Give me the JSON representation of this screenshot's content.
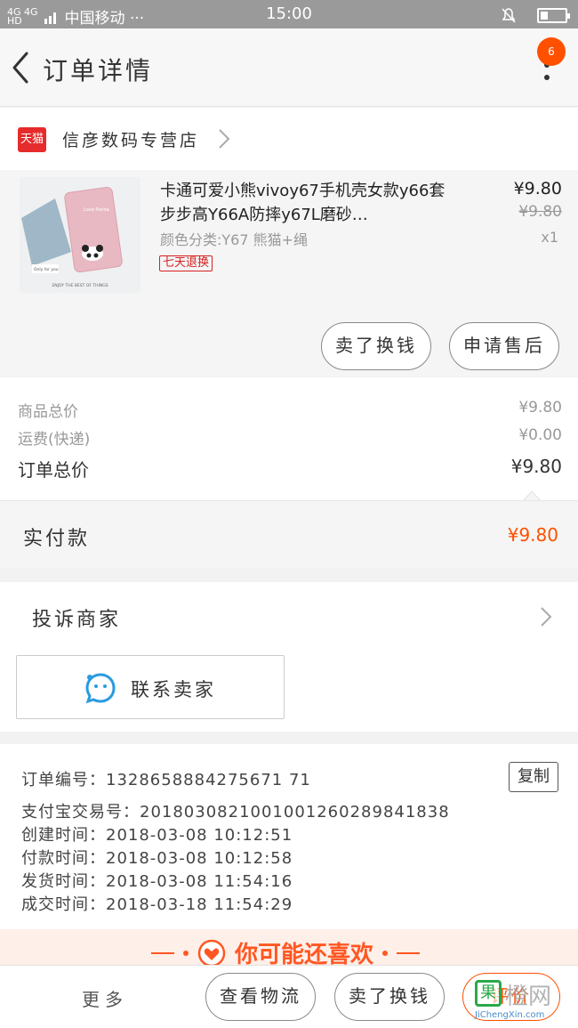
{
  "status_bar": {
    "signal_top": "4G 4G",
    "signal_bottom": "HD",
    "carrier": "中国移动 ···",
    "time": "15:00"
  },
  "nav": {
    "title": "订单详情",
    "badge_count": "6"
  },
  "shop": {
    "logo_text": "天猫",
    "name": "信彦数码专营店"
  },
  "item": {
    "title": "卡通可爱小熊vivoy67手机壳女款y66套步步高Y66A防摔y67L磨砂…",
    "sku": "颜色分类:Y67 熊猫+绳",
    "tag": "七天退换",
    "price": "¥9.80",
    "original_price": "¥9.80",
    "quantity": "x1",
    "image_caption": "ENJOY THE BEST OF THINGS",
    "image_card_text": "Only for you",
    "image_phone_text": "Love Panda",
    "buttons": [
      "卖了换钱",
      "申请售后"
    ]
  },
  "summary": {
    "goods_label": "商品总价",
    "goods_value": "¥9.80",
    "shipping_label": "运费(快递)",
    "shipping_value": "¥0.00",
    "total_label": "订单总价",
    "total_value": "¥9.80"
  },
  "paid": {
    "label": "实付款",
    "value": "¥9.80"
  },
  "complain": {
    "label": "投诉商家",
    "contact_label": "联系卖家"
  },
  "info": {
    "order_no": "订单编号：1328658884275671 71",
    "copy_label": "复制",
    "alipay_no": "支付宝交易号：2018030821001001260289841838",
    "created": "创建时间：2018-03-08  10:12:51",
    "paid_time": "付款时间：2018-03-08  10:12:58",
    "shipped": "发货时间：2018-03-08  11:54:16",
    "completed": "成交时间：2018-03-18  11:54:29"
  },
  "recommend": {
    "label": "你可能还喜欢"
  },
  "bottom_bar": {
    "more": "更多",
    "buttons": [
      "查看物流",
      "卖了换钱",
      "评价"
    ]
  },
  "watermark": {
    "box_char": "果",
    "text": "橙网",
    "url": "JiChengXin.com"
  },
  "colors": {
    "accent": "#ff5000",
    "tmall_red": "#e52b2b",
    "status_bar": "#9a9a9a"
  }
}
